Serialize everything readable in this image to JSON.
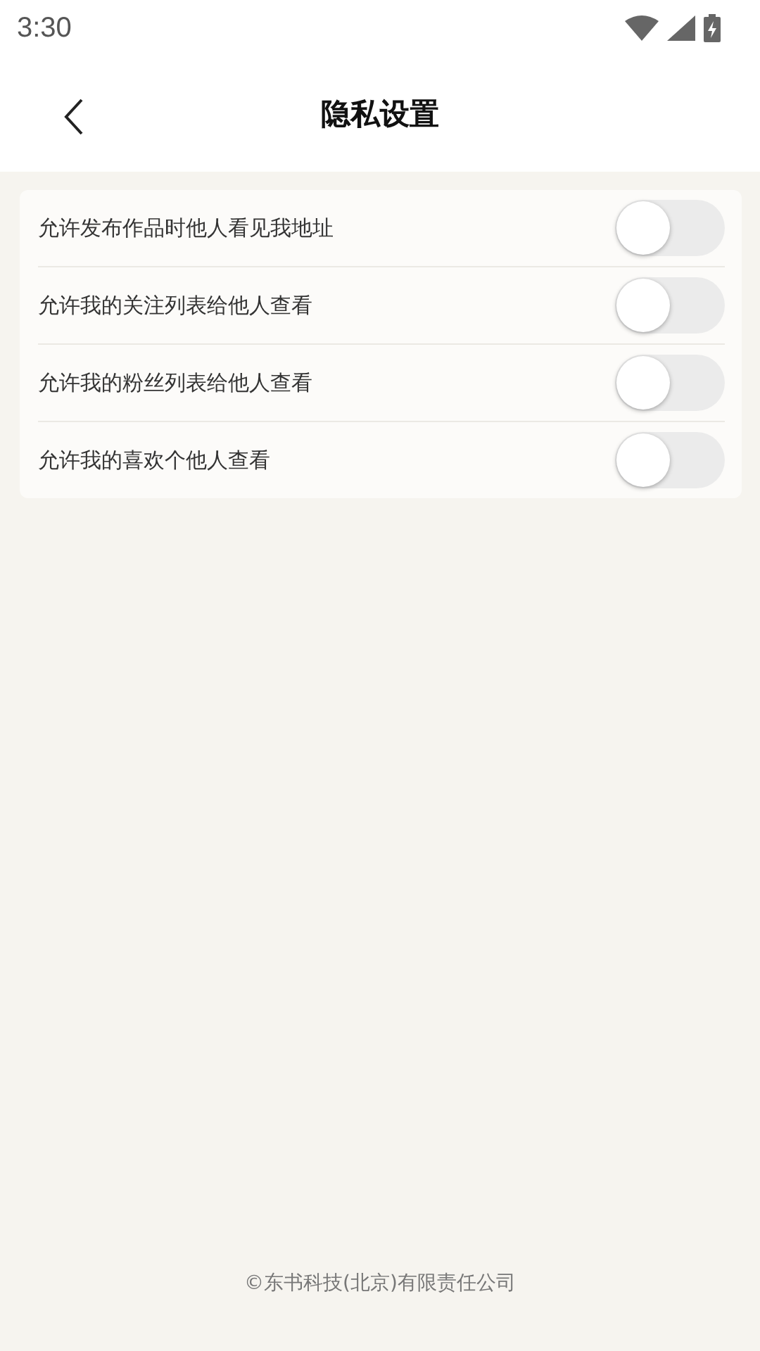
{
  "status_bar": {
    "time": "3:30"
  },
  "header": {
    "title": "隐私设置"
  },
  "settings": [
    {
      "label": "允许发布作品时他人看见我地址",
      "on": false
    },
    {
      "label": "允许我的关注列表给他人查看",
      "on": false
    },
    {
      "label": "允许我的粉丝列表给他人查看",
      "on": false
    },
    {
      "label": "允许我的喜欢个他人查看",
      "on": false
    }
  ],
  "footer": {
    "text": "©东书科技(北京)有限责任公司"
  }
}
